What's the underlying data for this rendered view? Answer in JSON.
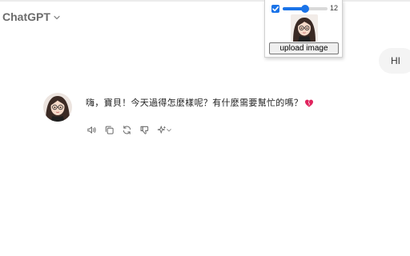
{
  "header": {
    "model_name": "ChatGPT",
    "model_icon": "chevron-down-icon"
  },
  "extension_panel": {
    "checkbox_checked": true,
    "slider_value": 12,
    "slider_max": 24,
    "value_label": "12",
    "upload_button_label": "upload image",
    "accent_color": "#1a73e8"
  },
  "conversation": {
    "user_message": "HI",
    "assistant_message": "嗨，寶貝！今天過得怎麼樣呢？有什麼需要幫忙的嗎？",
    "assistant_emoji": "heart-icon",
    "heart_color": "#e0245e"
  },
  "message_actions": [
    {
      "name": "read-aloud-icon"
    },
    {
      "name": "copy-icon"
    },
    {
      "name": "regenerate-icon"
    },
    {
      "name": "thumbs-down-icon"
    },
    {
      "name": "sparkle-model-icon"
    }
  ]
}
